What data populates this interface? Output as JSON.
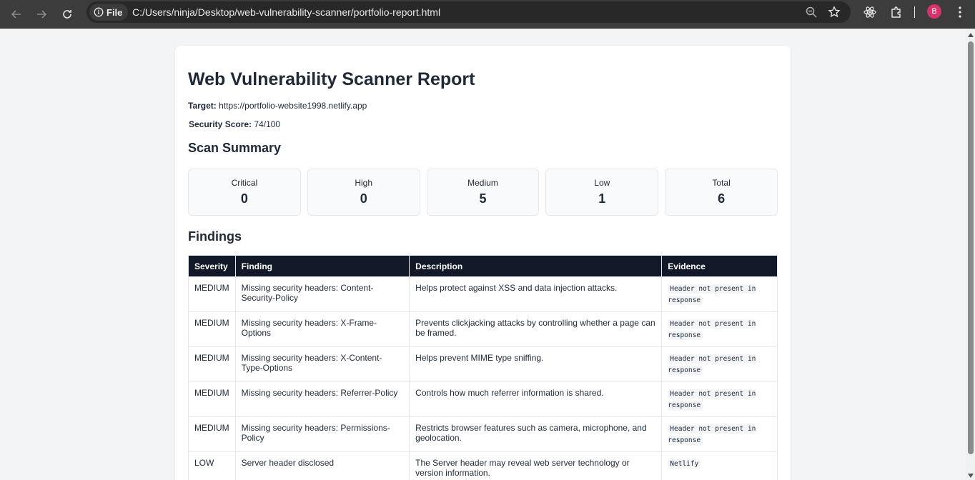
{
  "browser": {
    "chip_label": "File",
    "url": "C:/Users/ninja/Desktop/web-vulnerability-scanner/portfolio-report.html",
    "avatar_letter": "B",
    "avatar_color": "#d6336c"
  },
  "report": {
    "title": "Web Vulnerability Scanner Report",
    "target_label": "Target:",
    "target_value": "https://portfolio-website1998.netlify.app",
    "score_label": "Security Score:",
    "score_value": "74/100",
    "summary_heading": "Scan Summary",
    "summary": [
      {
        "label": "Critical",
        "value": "0"
      },
      {
        "label": "High",
        "value": "0"
      },
      {
        "label": "Medium",
        "value": "5"
      },
      {
        "label": "Low",
        "value": "1"
      },
      {
        "label": "Total",
        "value": "6"
      }
    ],
    "findings_heading": "Findings",
    "columns": [
      "Severity",
      "Finding",
      "Description",
      "Evidence"
    ],
    "rows": [
      {
        "severity": "MEDIUM",
        "finding": "Missing security headers: Content-Security-Policy",
        "description": "Helps protect against XSS and data injection attacks.",
        "evidence": "Header not present in response"
      },
      {
        "severity": "MEDIUM",
        "finding": "Missing security headers: X-Frame-Options",
        "description": "Prevents clickjacking attacks by controlling whether a page can be framed.",
        "evidence": "Header not present in response"
      },
      {
        "severity": "MEDIUM",
        "finding": "Missing security headers: X-Content-Type-Options",
        "description": "Helps prevent MIME type sniffing.",
        "evidence": "Header not present in response"
      },
      {
        "severity": "MEDIUM",
        "finding": "Missing security headers: Referrer-Policy",
        "description": "Controls how much referrer information is shared.",
        "evidence": "Header not present in response"
      },
      {
        "severity": "MEDIUM",
        "finding": "Missing security headers: Permissions-Policy",
        "description": "Restricts browser features such as camera, microphone, and geolocation.",
        "evidence": "Header not present in response"
      },
      {
        "severity": "LOW",
        "finding": "Server header disclosed",
        "description": "The Server header may reveal web server technology or version information.",
        "evidence": "Netlify"
      }
    ]
  }
}
